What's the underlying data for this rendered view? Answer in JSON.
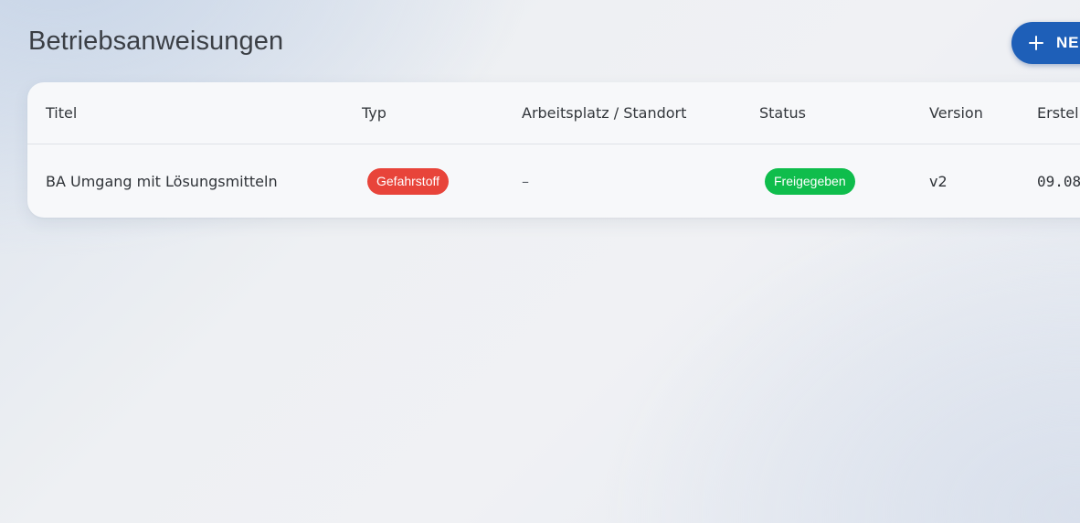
{
  "header": {
    "title": "Betriebsanweisungen",
    "new_button_label": "NEU",
    "new_button_icon": "plus-icon"
  },
  "colors": {
    "primary": "#1e5fb8",
    "badge_hazard": "#e8443a",
    "badge_released": "#0fbd4c"
  },
  "table": {
    "columns": [
      "Titel",
      "Typ",
      "Arbeitsplatz / Standort",
      "Status",
      "Version",
      "Erstellt"
    ],
    "rows": [
      {
        "title": "BA Umgang mit Lösungsmitteln",
        "type": "Gefahrstoff",
        "location": "–",
        "status": "Freigegeben",
        "version": "v2",
        "created": "09.08"
      }
    ]
  }
}
